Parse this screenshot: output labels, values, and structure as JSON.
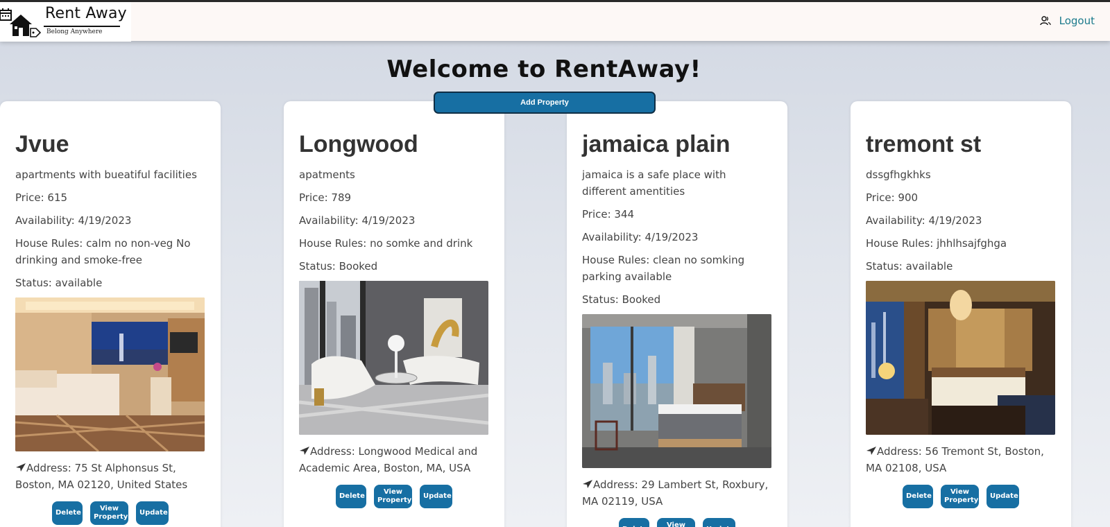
{
  "brand": {
    "name": "Rent Away",
    "tagline": "Belong Anywhere"
  },
  "nav": {
    "logout_label": "Logout"
  },
  "page": {
    "title": "Welcome to RentAway!",
    "add_property_label": "Add Property"
  },
  "actions": {
    "delete_label": "Delete",
    "view_label": "View Property",
    "update_label": "Update"
  },
  "colors": {
    "accent": "#176fa3",
    "link": "#1b7a8c"
  },
  "properties": [
    {
      "name": "Jvue",
      "description": "apartments with bueatiful facilities",
      "price": "Price: 615",
      "availability": "Availability: 4/19/2023",
      "rules": "House Rules: calm no non-veg No drinking and smoke-free",
      "status": "Status: available",
      "address": "Address: 75 St Alphonsus St, Boston, MA 02120, United States",
      "image_icon": "hotel-room-photo"
    },
    {
      "name": "Longwood",
      "description": "apatments",
      "price": "Price: 789",
      "availability": "Availability: 4/19/2023",
      "rules": "House Rules: no somke and drink",
      "status": "Status: Booked",
      "address": "Address: Longwood Medical and Academic Area, Boston, MA, USA",
      "image_icon": "living-room-photo"
    },
    {
      "name": "jamaica plain",
      "description": "jamaica is a safe place with different amentities",
      "price": "Price: 344",
      "availability": "Availability: 4/19/2023",
      "rules": "House Rules: clean no somking parking available",
      "status": "Status: Booked",
      "address": "Address: 29 Lambert St, Roxbury, MA 02119, USA",
      "image_icon": "bedroom-photo"
    },
    {
      "name": "tremont st",
      "description": "dssgfhgkhks",
      "price": "Price: 900",
      "availability": "Availability: 4/19/2023",
      "rules": "House Rules: jhhlhsajfghga",
      "status": "Status: available",
      "address": "Address: 56 Tremont St, Boston, MA 02108, USA",
      "image_icon": "suite-photo"
    }
  ]
}
